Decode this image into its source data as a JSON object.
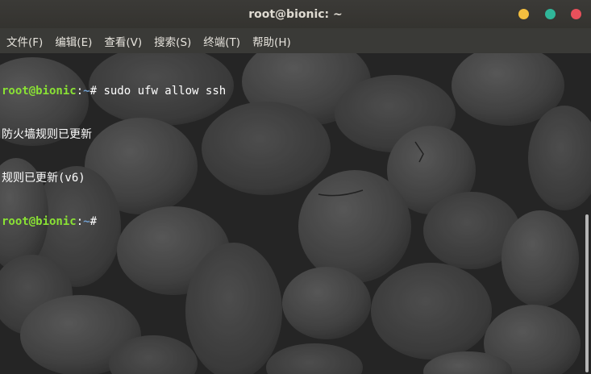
{
  "window": {
    "title": "root@bionic: ~",
    "controls": {
      "minimize_color": "#f4bf3f",
      "maximize_color": "#30b699",
      "close_color": "#e9505b"
    }
  },
  "menu": {
    "items": [
      {
        "label": "文件(F)"
      },
      {
        "label": "编辑(E)"
      },
      {
        "label": "查看(V)"
      },
      {
        "label": "搜索(S)"
      },
      {
        "label": "终端(T)"
      },
      {
        "label": "帮助(H)"
      }
    ]
  },
  "terminal": {
    "lines": [
      {
        "user_host": "root@bionic",
        "sep": ":",
        "path": "~",
        "symbol": "# ",
        "command": "sudo ufw allow ssh"
      },
      {
        "output": "防火墙规则已更新"
      },
      {
        "output": "规则已更新(v6)"
      },
      {
        "user_host": "root@bionic",
        "sep": ":",
        "path": "~",
        "symbol": "# ",
        "command": ""
      }
    ],
    "prompt_color": "#8ae234",
    "path_color": "#729fcf"
  }
}
